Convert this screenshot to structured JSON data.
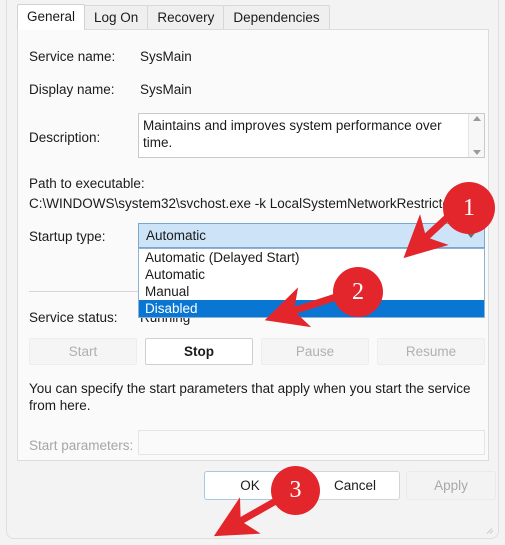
{
  "dialog": {
    "tabs": [
      {
        "label": "General",
        "active": true
      },
      {
        "label": "Log On",
        "active": false
      },
      {
        "label": "Recovery",
        "active": false
      },
      {
        "label": "Dependencies",
        "active": false
      }
    ],
    "fields": {
      "service_name_label": "Service name:",
      "service_name_value": "SysMain",
      "display_name_label": "Display name:",
      "display_name_value": "SysMain",
      "description_label": "Description:",
      "description_value": "Maintains and improves system performance over time.",
      "path_label": "Path to executable:",
      "path_value": "C:\\WINDOWS\\system32\\svchost.exe -k LocalSystemNetworkRestricted -p",
      "startup_type_label": "Startup type:",
      "startup_type_value": "Automatic",
      "service_status_label": "Service status:",
      "service_status_value": "Running",
      "start_parameters_label": "Start parameters:",
      "start_parameters_value": ""
    },
    "startup_options": [
      "Automatic (Delayed Start)",
      "Automatic",
      "Manual",
      "Disabled"
    ],
    "startup_selected_option": "Disabled",
    "service_buttons": [
      {
        "label": "Start",
        "enabled": false
      },
      {
        "label": "Stop",
        "enabled": true
      },
      {
        "label": "Pause",
        "enabled": false
      },
      {
        "label": "Resume",
        "enabled": false
      }
    ],
    "hint_text": "You can specify the start parameters that apply when you start the service from here.",
    "footer": {
      "ok_label": "OK",
      "cancel_label": "Cancel",
      "apply_label": "Apply"
    }
  },
  "annotations": {
    "step_1": "1",
    "step_2": "2",
    "step_3": "3"
  },
  "colors": {
    "accent_red": "#e3262c",
    "selection_blue": "#0a76d4",
    "combo_fill": "#cde3f7",
    "window_bg": "#f3f3f3"
  }
}
